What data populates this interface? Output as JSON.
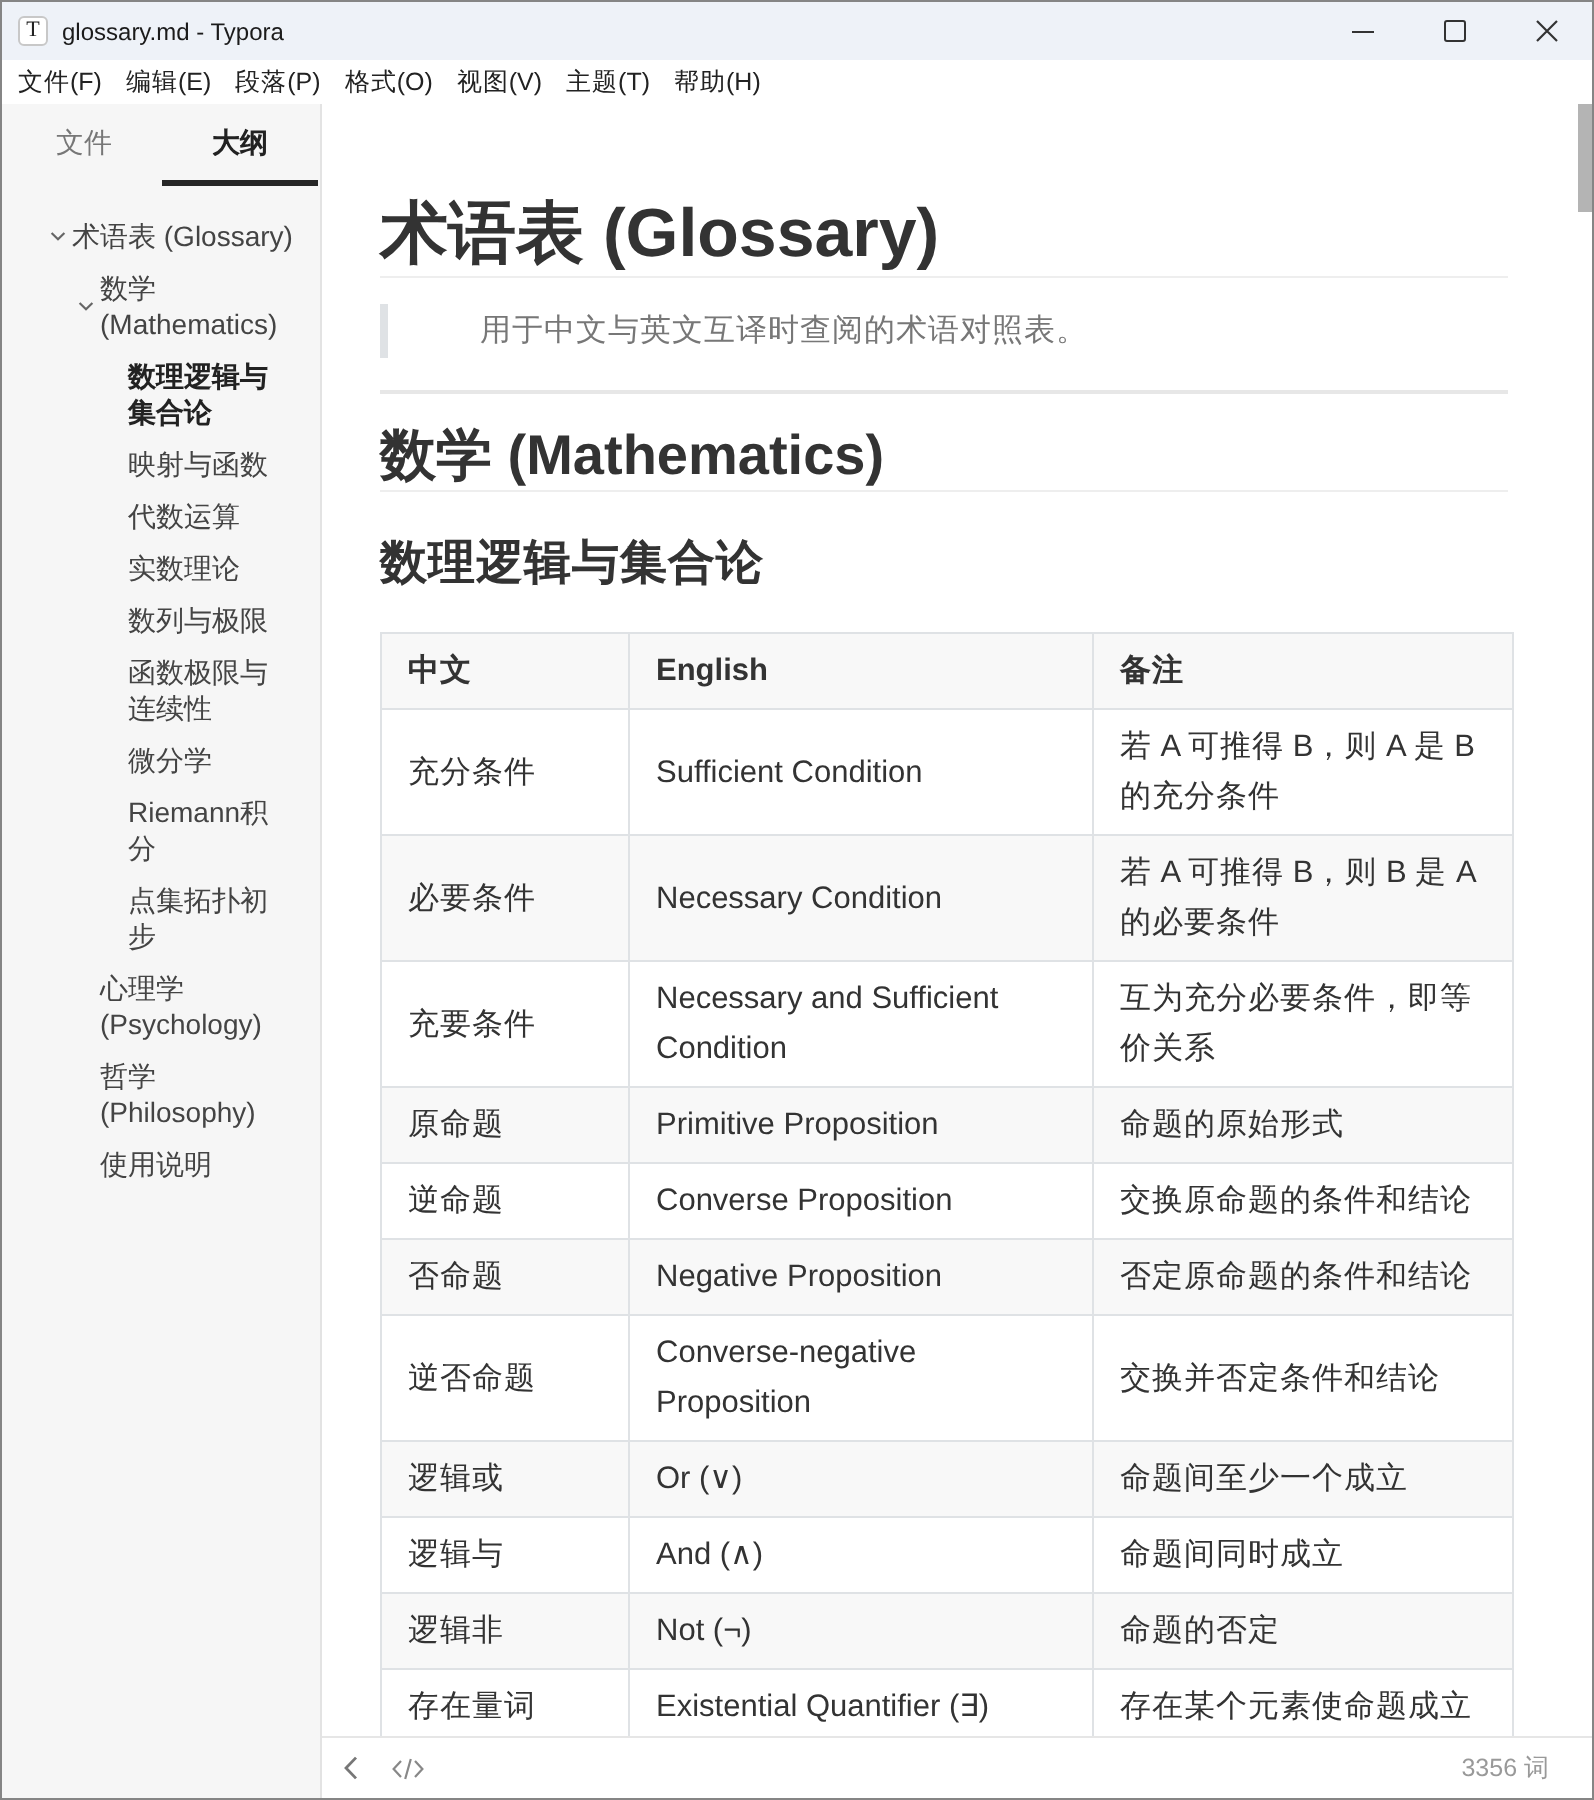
{
  "window": {
    "icon_letter": "T",
    "title": "glossary.md - Typora"
  },
  "menu": [
    "文件(F)",
    "编辑(E)",
    "段落(P)",
    "格式(O)",
    "视图(V)",
    "主题(T)",
    "帮助(H)"
  ],
  "sidebar": {
    "tabs": [
      {
        "label": "文件",
        "selected": false
      },
      {
        "label": "大纲",
        "selected": true
      }
    ],
    "outline": [
      {
        "label": "术语表 (Glossary)",
        "selected": false,
        "expanded": true,
        "children": [
          {
            "label": "数学 (Mathematics)",
            "selected": false,
            "expanded": true,
            "children": [
              {
                "label": "数理逻辑与集合论",
                "selected": true
              },
              {
                "label": "映射与函数",
                "selected": false
              },
              {
                "label": "代数运算",
                "selected": false
              },
              {
                "label": "实数理论",
                "selected": false
              },
              {
                "label": "数列与极限",
                "selected": false
              },
              {
                "label": "函数极限与连续性",
                "selected": false
              },
              {
                "label": "微分学",
                "selected": false
              },
              {
                "label": "Riemann积分",
                "selected": false
              },
              {
                "label": "点集拓扑初步",
                "selected": false
              }
            ]
          },
          {
            "label": "心理学 (Psychology)",
            "selected": false
          },
          {
            "label": "哲学 (Philosophy)",
            "selected": false
          },
          {
            "label": "使用说明",
            "selected": false
          }
        ]
      }
    ]
  },
  "document": {
    "title": "术语表 (Glossary)",
    "blockquote": "用于中文与英文互译时查阅的术语对照表。",
    "sections": [
      {
        "heading": "数学 (Mathematics)",
        "subheading": "数理逻辑与集合论",
        "table": {
          "columns": [
            "中文",
            "English",
            "备注"
          ],
          "rows": [
            [
              "充分条件",
              "Sufficient Condition",
              "若 A 可推得 B，则 A 是 B 的充分条件"
            ],
            [
              "必要条件",
              "Necessary Condition",
              "若 A 可推得 B，则 B 是 A 的必要条件"
            ],
            [
              "充要条件",
              "Necessary and Sufficient Condition",
              "互为充分必要条件，即等价关系"
            ],
            [
              "原命题",
              "Primitive Proposition",
              "命题的原始形式"
            ],
            [
              "逆命题",
              "Converse Proposition",
              "交换原命题的条件和结论"
            ],
            [
              "否命题",
              "Negative Proposition",
              "否定原命题的条件和结论"
            ],
            [
              "逆否命题",
              "Converse-negative Proposition",
              "交换并否定条件和结论"
            ],
            [
              "逻辑或",
              "Or (∨)",
              "命题间至少一个成立"
            ],
            [
              "逻辑与",
              "And (∧)",
              "命题间同时成立"
            ],
            [
              "逻辑非",
              "Not (¬)",
              "命题的否定"
            ],
            [
              "存在量词",
              "Existential Quantifier (∃)",
              "存在某个元素使命题成立"
            ]
          ]
        }
      }
    ]
  },
  "status_bar": {
    "word_count": "3356 词"
  }
}
